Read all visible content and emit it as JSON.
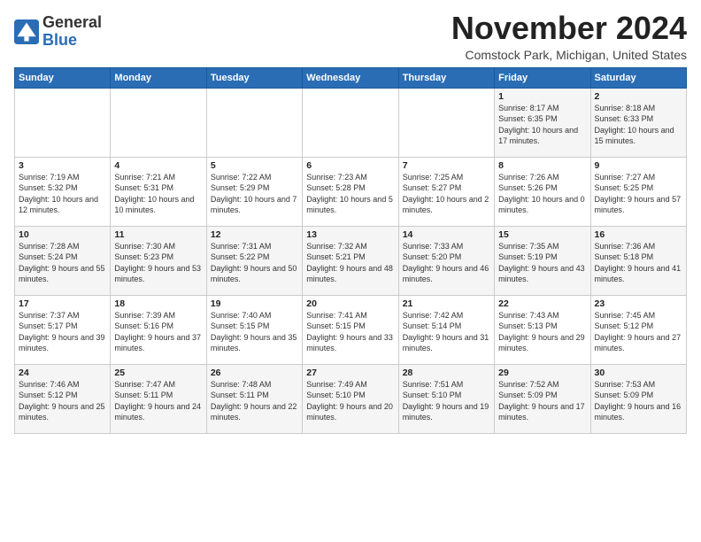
{
  "header": {
    "logo_general": "General",
    "logo_blue": "Blue",
    "month_title": "November 2024",
    "location": "Comstock Park, Michigan, United States"
  },
  "days_of_week": [
    "Sunday",
    "Monday",
    "Tuesday",
    "Wednesday",
    "Thursday",
    "Friday",
    "Saturday"
  ],
  "weeks": [
    [
      {
        "day": "",
        "info": ""
      },
      {
        "day": "",
        "info": ""
      },
      {
        "day": "",
        "info": ""
      },
      {
        "day": "",
        "info": ""
      },
      {
        "day": "",
        "info": ""
      },
      {
        "day": "1",
        "info": "Sunrise: 8:17 AM\nSunset: 6:35 PM\nDaylight: 10 hours and 17 minutes."
      },
      {
        "day": "2",
        "info": "Sunrise: 8:18 AM\nSunset: 6:33 PM\nDaylight: 10 hours and 15 minutes."
      }
    ],
    [
      {
        "day": "3",
        "info": "Sunrise: 7:19 AM\nSunset: 5:32 PM\nDaylight: 10 hours and 12 minutes."
      },
      {
        "day": "4",
        "info": "Sunrise: 7:21 AM\nSunset: 5:31 PM\nDaylight: 10 hours and 10 minutes."
      },
      {
        "day": "5",
        "info": "Sunrise: 7:22 AM\nSunset: 5:29 PM\nDaylight: 10 hours and 7 minutes."
      },
      {
        "day": "6",
        "info": "Sunrise: 7:23 AM\nSunset: 5:28 PM\nDaylight: 10 hours and 5 minutes."
      },
      {
        "day": "7",
        "info": "Sunrise: 7:25 AM\nSunset: 5:27 PM\nDaylight: 10 hours and 2 minutes."
      },
      {
        "day": "8",
        "info": "Sunrise: 7:26 AM\nSunset: 5:26 PM\nDaylight: 10 hours and 0 minutes."
      },
      {
        "day": "9",
        "info": "Sunrise: 7:27 AM\nSunset: 5:25 PM\nDaylight: 9 hours and 57 minutes."
      }
    ],
    [
      {
        "day": "10",
        "info": "Sunrise: 7:28 AM\nSunset: 5:24 PM\nDaylight: 9 hours and 55 minutes."
      },
      {
        "day": "11",
        "info": "Sunrise: 7:30 AM\nSunset: 5:23 PM\nDaylight: 9 hours and 53 minutes."
      },
      {
        "day": "12",
        "info": "Sunrise: 7:31 AM\nSunset: 5:22 PM\nDaylight: 9 hours and 50 minutes."
      },
      {
        "day": "13",
        "info": "Sunrise: 7:32 AM\nSunset: 5:21 PM\nDaylight: 9 hours and 48 minutes."
      },
      {
        "day": "14",
        "info": "Sunrise: 7:33 AM\nSunset: 5:20 PM\nDaylight: 9 hours and 46 minutes."
      },
      {
        "day": "15",
        "info": "Sunrise: 7:35 AM\nSunset: 5:19 PM\nDaylight: 9 hours and 43 minutes."
      },
      {
        "day": "16",
        "info": "Sunrise: 7:36 AM\nSunset: 5:18 PM\nDaylight: 9 hours and 41 minutes."
      }
    ],
    [
      {
        "day": "17",
        "info": "Sunrise: 7:37 AM\nSunset: 5:17 PM\nDaylight: 9 hours and 39 minutes."
      },
      {
        "day": "18",
        "info": "Sunrise: 7:39 AM\nSunset: 5:16 PM\nDaylight: 9 hours and 37 minutes."
      },
      {
        "day": "19",
        "info": "Sunrise: 7:40 AM\nSunset: 5:15 PM\nDaylight: 9 hours and 35 minutes."
      },
      {
        "day": "20",
        "info": "Sunrise: 7:41 AM\nSunset: 5:15 PM\nDaylight: 9 hours and 33 minutes."
      },
      {
        "day": "21",
        "info": "Sunrise: 7:42 AM\nSunset: 5:14 PM\nDaylight: 9 hours and 31 minutes."
      },
      {
        "day": "22",
        "info": "Sunrise: 7:43 AM\nSunset: 5:13 PM\nDaylight: 9 hours and 29 minutes."
      },
      {
        "day": "23",
        "info": "Sunrise: 7:45 AM\nSunset: 5:12 PM\nDaylight: 9 hours and 27 minutes."
      }
    ],
    [
      {
        "day": "24",
        "info": "Sunrise: 7:46 AM\nSunset: 5:12 PM\nDaylight: 9 hours and 25 minutes."
      },
      {
        "day": "25",
        "info": "Sunrise: 7:47 AM\nSunset: 5:11 PM\nDaylight: 9 hours and 24 minutes."
      },
      {
        "day": "26",
        "info": "Sunrise: 7:48 AM\nSunset: 5:11 PM\nDaylight: 9 hours and 22 minutes."
      },
      {
        "day": "27",
        "info": "Sunrise: 7:49 AM\nSunset: 5:10 PM\nDaylight: 9 hours and 20 minutes."
      },
      {
        "day": "28",
        "info": "Sunrise: 7:51 AM\nSunset: 5:10 PM\nDaylight: 9 hours and 19 minutes."
      },
      {
        "day": "29",
        "info": "Sunrise: 7:52 AM\nSunset: 5:09 PM\nDaylight: 9 hours and 17 minutes."
      },
      {
        "day": "30",
        "info": "Sunrise: 7:53 AM\nSunset: 5:09 PM\nDaylight: 9 hours and 16 minutes."
      }
    ]
  ]
}
